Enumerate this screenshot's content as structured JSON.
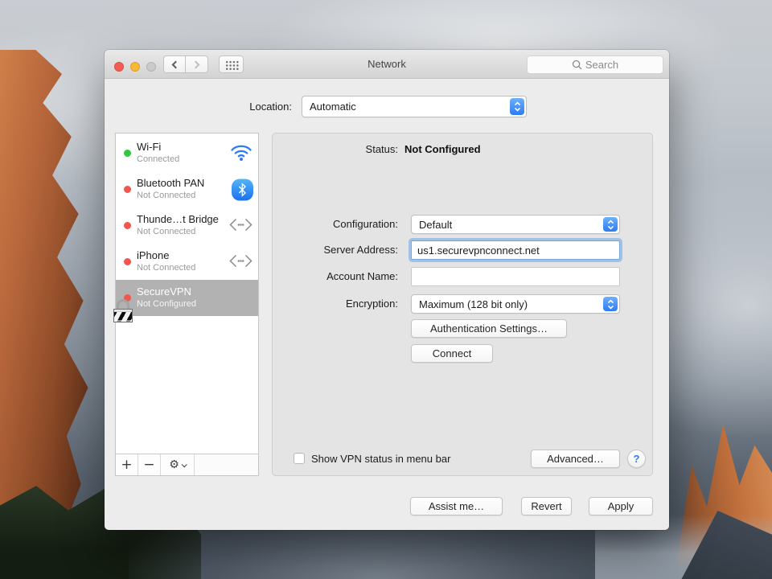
{
  "colors": {
    "accent_blue": "#2d7bf5",
    "selection_gray": "#b2b2b2",
    "status_green": "#35c53f",
    "status_red": "#f2564e"
  },
  "titlebar": {
    "title": "Network",
    "search_placeholder": "Search"
  },
  "location_row": {
    "label": "Location:",
    "value": "Automatic"
  },
  "sidebar": {
    "items": [
      {
        "name": "Wi-Fi",
        "status": "Connected",
        "dot_color": "#35c53f",
        "icon": "wifi-icon",
        "selected": false
      },
      {
        "name": "Bluetooth PAN",
        "status": "Not Connected",
        "dot_color": "#f2564e",
        "icon": "bluetooth-icon",
        "selected": false
      },
      {
        "name": "Thunde…t Bridge",
        "status": "Not Connected",
        "dot_color": "#f2564e",
        "icon": "bridge-icon",
        "selected": false
      },
      {
        "name": "iPhone",
        "status": "Not Connected",
        "dot_color": "#f2564e",
        "icon": "bridge-icon",
        "selected": false
      },
      {
        "name": "SecureVPN",
        "status": "Not Configured",
        "dot_color": "#f2564e",
        "icon": "vpn-lock-icon",
        "selected": true
      }
    ],
    "add_label": "+",
    "remove_label": "−",
    "gear_label": "⚙"
  },
  "panel": {
    "status_label": "Status:",
    "status_value": "Not Configured",
    "fields": {
      "configuration": {
        "label": "Configuration:",
        "value": "Default",
        "type": "popup"
      },
      "server_address": {
        "label": "Server Address:",
        "value": "us1.securevpnconnect.net",
        "focused": true
      },
      "account_name": {
        "label": "Account Name:",
        "value": "",
        "placeholder": ""
      },
      "encryption": {
        "label": "Encryption:",
        "value": "Maximum (128 bit only)",
        "type": "popup"
      }
    },
    "buttons": {
      "authentication": "Authentication Settings…",
      "connect": "Connect",
      "advanced": "Advanced…",
      "help": "?"
    },
    "checkbox_label": "Show VPN status in menu bar",
    "checkbox_checked": false
  },
  "footer": {
    "assist": "Assist me…",
    "revert": "Revert",
    "apply": "Apply"
  }
}
